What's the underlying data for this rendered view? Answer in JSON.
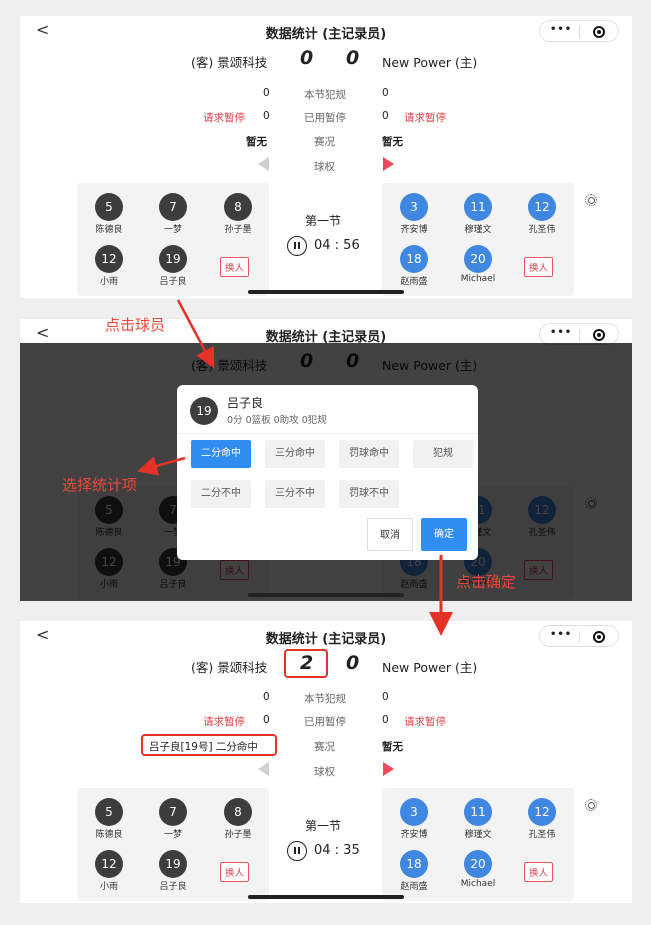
{
  "nav": {
    "back": "<",
    "title": "数据统计 (主记录员)",
    "more": "•••"
  },
  "teams": {
    "guest": "(客) 景颂科技",
    "home": "New Power (主)"
  },
  "labels": {
    "fouls": "本节犯规",
    "timeouts": "已用暂停",
    "situation": "赛况",
    "possession": "球权",
    "request_timeout": "请求暂停",
    "swap": "换人",
    "quarter": "第一节"
  },
  "guest_players": [
    {
      "num": "5",
      "name": "陈德良"
    },
    {
      "num": "7",
      "name": "一梦"
    },
    {
      "num": "8",
      "name": "孙子墨"
    },
    {
      "num": "12",
      "name": "小雨"
    },
    {
      "num": "19",
      "name": "吕子良"
    }
  ],
  "home_players": [
    {
      "num": "3",
      "name": "齐安博"
    },
    {
      "num": "11",
      "name": "穆瑾文"
    },
    {
      "num": "12",
      "name": "孔圣伟"
    },
    {
      "num": "18",
      "name": "赵雨盛"
    },
    {
      "num": "20",
      "name": "Michael"
    }
  ],
  "screens": [
    {
      "guest_score": "0",
      "home_score": "0",
      "guest_fouls": "0",
      "home_fouls": "0",
      "guest_timeouts": "0",
      "home_timeouts": "0",
      "guest_situation": "暂无",
      "home_situation": "暂无",
      "clock": "04 : 56"
    },
    {
      "guest_score": "0",
      "home_score": "0"
    },
    {
      "guest_score": "2",
      "home_score": "0",
      "guest_fouls": "0",
      "home_fouls": "0",
      "guest_timeouts": "0",
      "home_timeouts": "0",
      "guest_situation": "吕子良[19号] 二分命中",
      "home_situation": "暂无",
      "clock": "04 : 35"
    }
  ],
  "modal": {
    "num": "19",
    "name": "吕子良",
    "stats": "0分  0篮板  0助攻  0犯规",
    "buttons": [
      "二分命中",
      "三分命中",
      "罚球命中",
      "犯规",
      "二分不中",
      "三分不中",
      "罚球不中"
    ],
    "selected": "二分命中",
    "cancel": "取消",
    "confirm": "确定"
  },
  "annotations": {
    "click_player": "点击球员",
    "select_stat": "选择统计项",
    "click_confirm": "点击确定"
  },
  "colors": {
    "accent_red": "#e7404a",
    "primary_blue": "#2f8ef0",
    "guest_circle": "#3d3d3d",
    "home_circle": "#3f87e0",
    "annotation_red": "#f0463a"
  }
}
